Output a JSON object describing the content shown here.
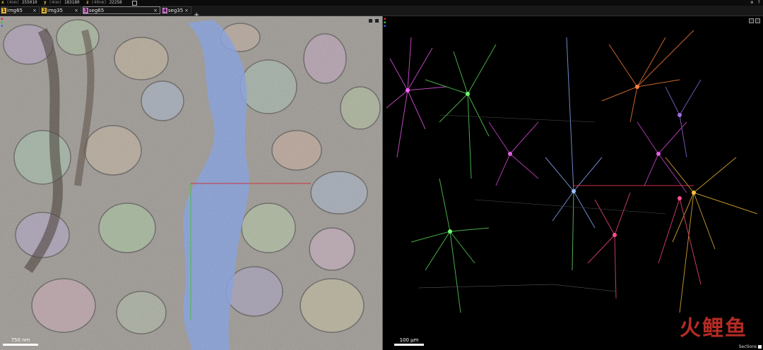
{
  "coords": {
    "x": {
      "axis": "x",
      "unit": "(4nm)",
      "value": "255010"
    },
    "y": {
      "axis": "y",
      "unit": "(4nm)",
      "value": "183180"
    },
    "z": {
      "axis": "z",
      "unit": "(40nm)",
      "value": "22258"
    }
  },
  "tabs": [
    {
      "num": "1",
      "label": "img65",
      "color": "#e8b830"
    },
    {
      "num": "2",
      "label": "img35",
      "color": "#e8b830"
    },
    {
      "num": "3",
      "label": "seg65",
      "color": "#d070d0"
    },
    {
      "num": "4",
      "label": "seg35",
      "color": "#d070d0"
    }
  ],
  "add_tab": "+",
  "close_symbol": "×",
  "em_panel": {
    "scale_label": "750 nm"
  },
  "mesh_panel": {
    "scale_label": "100 µm",
    "sections_label": "Sections"
  },
  "icons": [
    "copy-icon",
    "settings-icon",
    "help-icon",
    "layout-icon",
    "maximize-icon"
  ],
  "colors": {
    "accent": "#e8b830",
    "crosshair_red": "#d03040",
    "crosshair_green": "#40c040",
    "neuron_blue": "#7a9ae0"
  },
  "watermark": "火鲤鱼"
}
